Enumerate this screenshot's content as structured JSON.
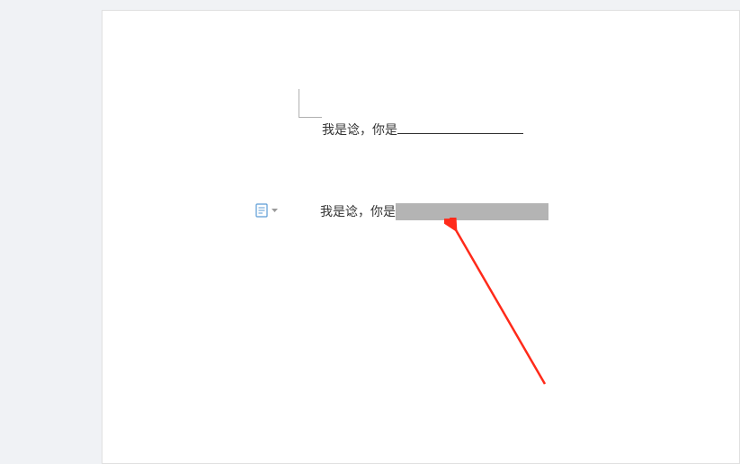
{
  "document": {
    "line1_prefix": "我是谂，你是",
    "line2_prefix": "我是谂，你是"
  },
  "icons": {
    "doc": "document-icon",
    "dropdown": "chevron-down-icon"
  },
  "annotation": {
    "arrow_color": "#ff2a1a"
  }
}
